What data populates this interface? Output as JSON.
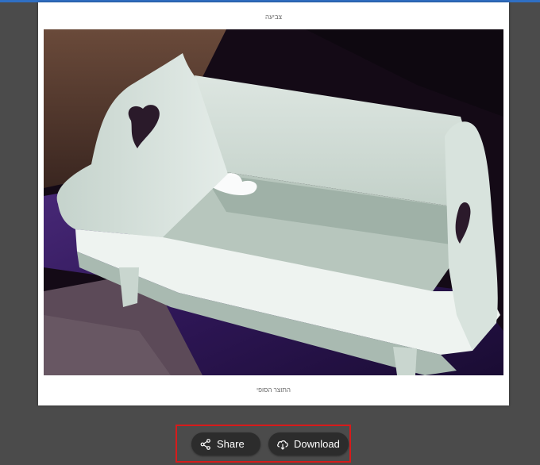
{
  "document": {
    "caption_top": "צביעה",
    "caption_bottom": "התוצר הסופי"
  },
  "toolbar": {
    "share_label": "Share",
    "download_label": "Download",
    "share_icon": "share-icon",
    "download_icon": "cloud-download-icon"
  },
  "colors": {
    "background": "#4b4b4b",
    "button_bg": "#2c2c2c",
    "highlight_border": "#d61b1b"
  }
}
